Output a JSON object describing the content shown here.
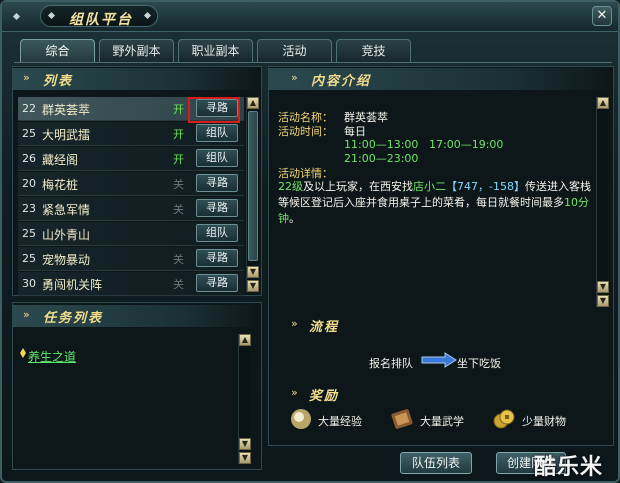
{
  "window": {
    "title": "组队平台",
    "close_label": "✕"
  },
  "tabs": [
    {
      "label": "综合",
      "active": true
    },
    {
      "label": "野外副本",
      "active": false
    },
    {
      "label": "职业副本",
      "active": false
    },
    {
      "label": "活动",
      "active": false
    },
    {
      "label": "竞技",
      "active": false
    }
  ],
  "list": {
    "heading": "列表",
    "rows": [
      {
        "level": "22",
        "name": "群英荟萃",
        "status": "开",
        "button": "寻路"
      },
      {
        "level": "25",
        "name": "大明武擂",
        "status": "开",
        "button": "组队"
      },
      {
        "level": "26",
        "name": "藏经阁",
        "status": "开",
        "button": "组队"
      },
      {
        "level": "20",
        "name": "梅花桩",
        "status": "关",
        "button": "寻路"
      },
      {
        "level": "23",
        "name": "紧急军情",
        "status": "关",
        "button": "寻路"
      },
      {
        "level": "25",
        "name": "山外青山",
        "status": "",
        "button": "组队"
      },
      {
        "level": "25",
        "name": "宠物暴动",
        "status": "关",
        "button": "寻路"
      },
      {
        "level": "30",
        "name": "勇闯机关阵",
        "status": "关",
        "button": "寻路"
      }
    ]
  },
  "tasks": {
    "heading": "任务列表",
    "items": [
      {
        "label": "养生之道"
      }
    ]
  },
  "content": {
    "heading": "内容介绍",
    "name_label": "活动名称：",
    "name_value": "群英荟萃",
    "time_label": "活动时间：",
    "time_value": "每日",
    "times": [
      "11:00—13:00",
      "17:00—19:00",
      "21:00—23:00"
    ],
    "detail_label": "活动详情：",
    "detail": {
      "level": "22级",
      "part1": "及以上玩家，在西安找",
      "npc": "店小二",
      "coords": "【747，-158】",
      "part2": "传送进入客栈等候区登记后入座并食用桌子上的菜肴，每日就餐时间最多",
      "minutes": "10分钟",
      "end": "。"
    }
  },
  "flow": {
    "heading": "流程",
    "step1": "报名排队",
    "step2": "坐下吃饭"
  },
  "rewards": {
    "heading": "奖励",
    "items": [
      {
        "label": "大量经验",
        "icon": "experience-orb-icon"
      },
      {
        "label": "大量武学",
        "icon": "martial-scroll-icon"
      },
      {
        "label": "少量财物",
        "icon": "coins-icon"
      }
    ]
  },
  "buttons": {
    "team_list": "队伍列表",
    "create_team": "创建队伍"
  },
  "watermark": "酷乐米"
}
